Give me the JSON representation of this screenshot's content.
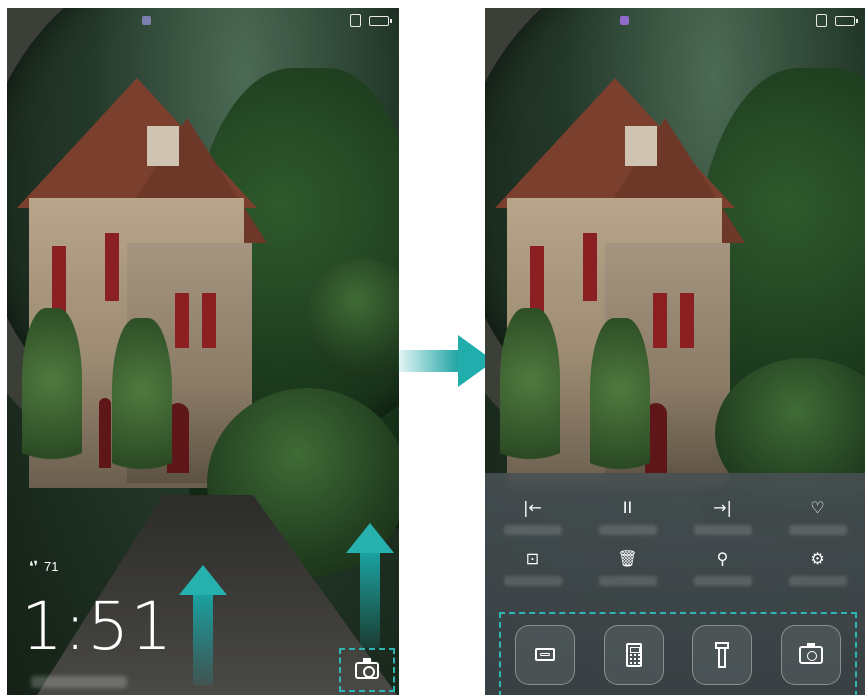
{
  "left_screen": {
    "steps_icon": "footprints-icon",
    "steps_count": "71",
    "time": "1:51",
    "swipe_hint_icon": "swipe-up-arrow-icon",
    "camera_icon": "camera-icon"
  },
  "right_screen": {
    "music_controls": [
      {
        "glyph": "|←",
        "icon": "previous-icon"
      },
      {
        "glyph": "II",
        "icon": "pause-icon"
      },
      {
        "glyph": "→|",
        "icon": "next-icon"
      },
      {
        "glyph": "♡",
        "icon": "like-icon"
      },
      {
        "glyph": "⊡",
        "icon": "covers-icon"
      },
      {
        "glyph": "🗑",
        "icon": "remove-icon"
      },
      {
        "glyph": "⚲",
        "icon": "share-icon"
      },
      {
        "glyph": "⚙",
        "icon": "settings-icon"
      }
    ],
    "shortcuts": [
      "recorder-icon",
      "calculator-icon",
      "flashlight-icon",
      "camera-icon"
    ]
  },
  "colors": {
    "accent": "#1aa3a3",
    "panel": "#4a5358"
  }
}
